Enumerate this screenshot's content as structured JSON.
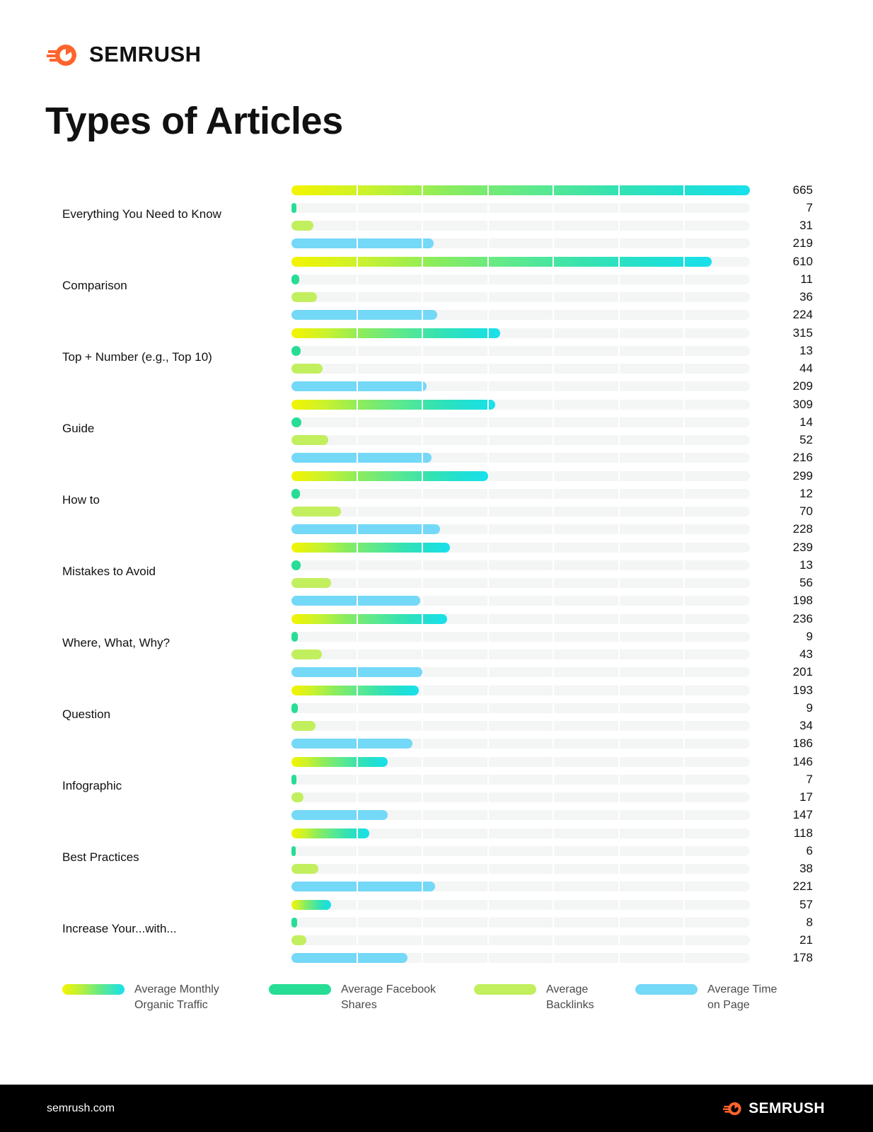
{
  "brand": {
    "name": "SEMRUSH",
    "logo_icon": "semrush-flame-icon",
    "accent_color": "#FF642D"
  },
  "header": {
    "title": "Types of Articles"
  },
  "footer": {
    "url": "semrush.com",
    "brand": "SEMRUSH",
    "background": "#000000"
  },
  "legend": {
    "items": [
      {
        "label_line1": "Average Monthly",
        "label_line2": "Organic Traffic",
        "swatch": "traffic",
        "color": "gradient-yellow-to-cyan"
      },
      {
        "label_line1": "Average Facebook",
        "label_line2": "Shares",
        "swatch": "fb",
        "color": "#27DD96"
      },
      {
        "label_line1": "Average",
        "label_line2": "Backlinks",
        "swatch": "bl",
        "color": "#C2EF5E"
      },
      {
        "label_line1": "Average Time",
        "label_line2": "on Page",
        "swatch": "tp",
        "color": "#74D8F7"
      }
    ]
  },
  "chart_data": {
    "type": "bar",
    "title": "Types of Articles",
    "orientation": "horizontal",
    "grouped": true,
    "segments_per_track": 7,
    "track_color": "#F4F5F5",
    "xlabel": "",
    "ylabel": "",
    "categories": [
      "Everything You Need to Know",
      "Comparison",
      "Top + Number (e.g., Top 10)",
      "Guide",
      "How to",
      "Mistakes to Avoid",
      "Where, What, Why?",
      "Question",
      "Infographic",
      "Best Practices",
      "Increase Your...with..."
    ],
    "series": [
      {
        "name": "Average Monthly Organic Traffic",
        "key": "traffic",
        "color": "gradient-yellow-to-cyan",
        "max": 665,
        "values": [
          665,
          610,
          315,
          309,
          299,
          239,
          236,
          193,
          146,
          118,
          57
        ]
      },
      {
        "name": "Average Facebook Shares",
        "key": "fb",
        "color": "#27DD96",
        "max": 14,
        "values": [
          7,
          11,
          13,
          14,
          12,
          13,
          9,
          9,
          7,
          6,
          8
        ]
      },
      {
        "name": "Average Backlinks",
        "key": "bl",
        "color": "#C2EF5E",
        "max": 70,
        "values": [
          31,
          36,
          44,
          52,
          70,
          56,
          43,
          34,
          17,
          38,
          21
        ]
      },
      {
        "name": "Average Time on Page",
        "key": "tp",
        "color": "#74D8F7",
        "max": 228,
        "values": [
          219,
          224,
          209,
          216,
          228,
          198,
          201,
          186,
          147,
          221,
          178
        ]
      }
    ],
    "bar_pixel_widths": {
      "traffic": [
        648,
        594,
        295,
        288,
        278,
        224,
        220,
        180,
        136,
        110,
        56
      ],
      "fb": [
        7,
        11,
        13,
        14,
        12,
        13,
        9,
        9,
        7,
        6,
        8
      ],
      "bl": [
        31,
        36,
        44,
        52,
        70,
        56,
        43,
        34,
        17,
        38,
        21
      ],
      "tp": [
        201,
        206,
        191,
        198,
        210,
        182,
        185,
        171,
        136,
        203,
        164
      ]
    }
  }
}
